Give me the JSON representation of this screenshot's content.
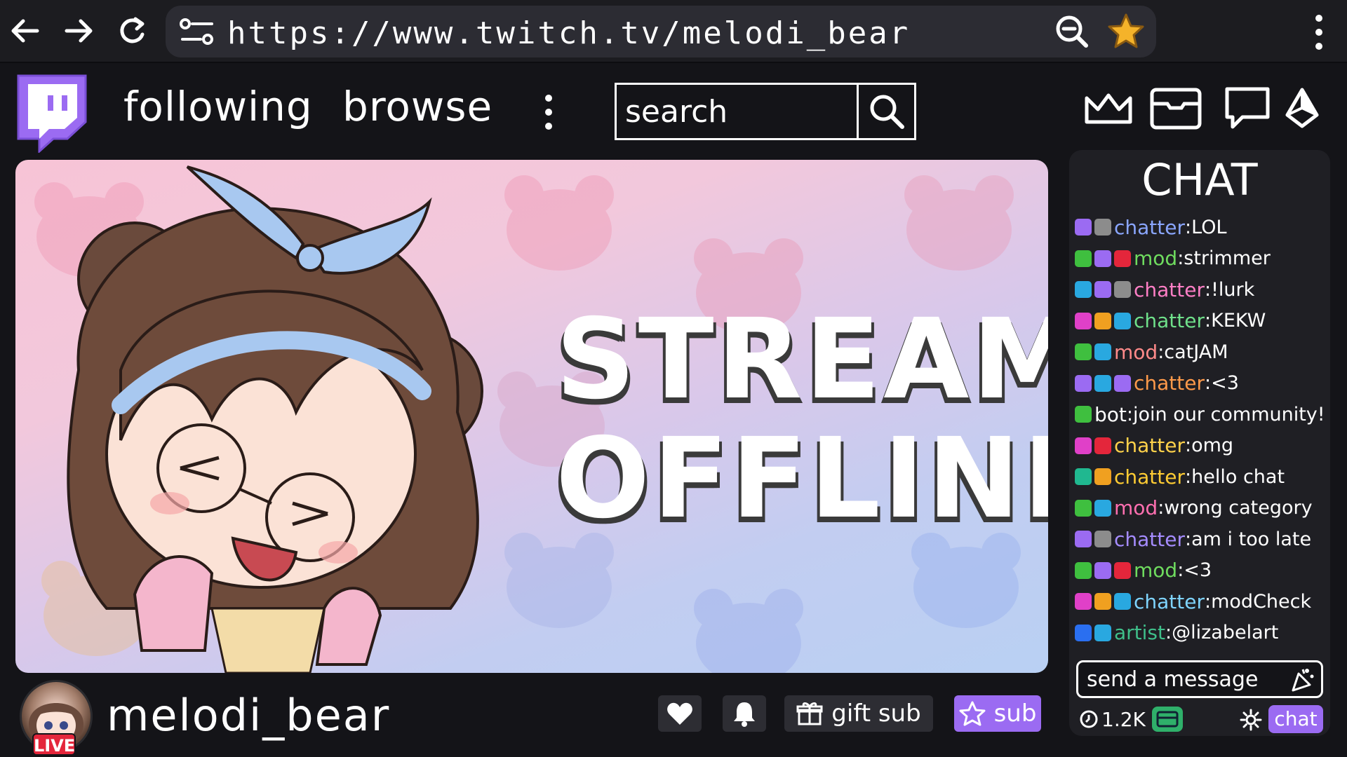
{
  "browser": {
    "url": "https://www.twitch.tv/melodi_bear"
  },
  "header": {
    "nav": [
      "following",
      "browse"
    ],
    "search_placeholder": "search"
  },
  "player": {
    "offline_line1": "STREAM",
    "offline_line2": "OFFLINE"
  },
  "chat": {
    "title": "CHAT",
    "messages": [
      {
        "name": "chatter",
        "msg": "LOL",
        "color": "#8aa6ff",
        "badges": [
          "#9b6bf2",
          "#8c8c8c"
        ]
      },
      {
        "name": "mod",
        "msg": "strimmer",
        "color": "#6fdc5f",
        "badges": [
          "#3fbf3f",
          "#9b6bf2",
          "#e4263b"
        ]
      },
      {
        "name": "chatter",
        "msg": "!lurk",
        "color": "#ff7fc6",
        "badges": [
          "#29a8e0",
          "#9b6bf2",
          "#8c8c8c"
        ]
      },
      {
        "name": "chatter",
        "msg": "KEKW",
        "color": "#6fe08a",
        "badges": [
          "#e040c8",
          "#f0a020",
          "#29a8e0"
        ]
      },
      {
        "name": "mod",
        "msg": "catJAM",
        "color": "#ff8a8a",
        "badges": [
          "#3fbf3f",
          "#29a8e0"
        ]
      },
      {
        "name": "chatter",
        "msg": "<3",
        "color": "#ff9a4a",
        "badges": [
          "#9b6bf2",
          "#29a8e0",
          "#9b6bf2"
        ]
      },
      {
        "name": "bot",
        "msg": "join our community!",
        "color": "#ffffff",
        "badges": [
          "#3fbf3f"
        ]
      },
      {
        "name": "chatter",
        "msg": "omg",
        "color": "#ffd24a",
        "badges": [
          "#e040c8",
          "#e4263b"
        ]
      },
      {
        "name": "chatter",
        "msg": "hello chat",
        "color": "#ffcc33",
        "badges": [
          "#20b890",
          "#f0a020"
        ]
      },
      {
        "name": "mod",
        "msg": "wrong category",
        "color": "#ff6fb0",
        "badges": [
          "#3fbf3f",
          "#29a8e0"
        ]
      },
      {
        "name": "chatter",
        "msg": "am i too late",
        "color": "#a58cff",
        "badges": [
          "#9b6bf2",
          "#8c8c8c"
        ]
      },
      {
        "name": "mod",
        "msg": "<3",
        "color": "#6fdc5f",
        "badges": [
          "#3fbf3f",
          "#9b6bf2",
          "#e4263b"
        ]
      },
      {
        "name": "chatter",
        "msg": "modCheck",
        "color": "#7fd4ff",
        "badges": [
          "#e040c8",
          "#f0a020",
          "#29a8e0"
        ]
      },
      {
        "name": "artist",
        "msg": "@lizabelart",
        "color": "#3fbf8a",
        "badges": [
          "#2a6ff0",
          "#29a8e0"
        ]
      }
    ],
    "input_placeholder": "send a message",
    "viewers": "1.2K",
    "chat_button": "chat"
  },
  "channel": {
    "name": "melodi_bear",
    "live": "LIVE",
    "gift_label": "gift sub",
    "sub_label": "sub"
  }
}
